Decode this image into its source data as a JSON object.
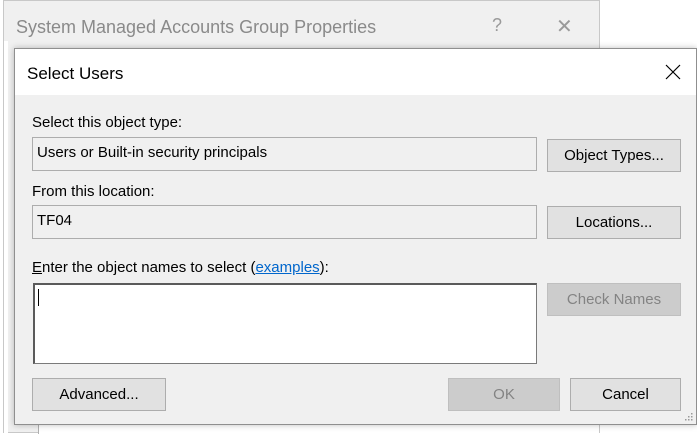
{
  "parent_window": {
    "title": "System Managed Accounts Group Properties",
    "help_glyph": "?",
    "close_glyph": "✕"
  },
  "dialog": {
    "title": "Select Users",
    "object_type_label": "Select this object type:",
    "object_type_value": "Users or Built-in security principals",
    "object_types_button": "Object Types...",
    "location_label": "From this location:",
    "location_value": "TF04",
    "locations_button": "Locations...",
    "names_label_prefix_ul": "E",
    "names_label_prefix": "nter the object names to select (",
    "names_label_link": "examples",
    "names_label_suffix": "):",
    "names_value": "",
    "check_names_button": "Check Names",
    "advanced_button": "Advanced...",
    "ok_button": "OK",
    "cancel_button": "Cancel"
  },
  "colors": {
    "dialog_bg": "#f0f0f0",
    "link": "#0066cc",
    "disabled_text": "#838383"
  }
}
